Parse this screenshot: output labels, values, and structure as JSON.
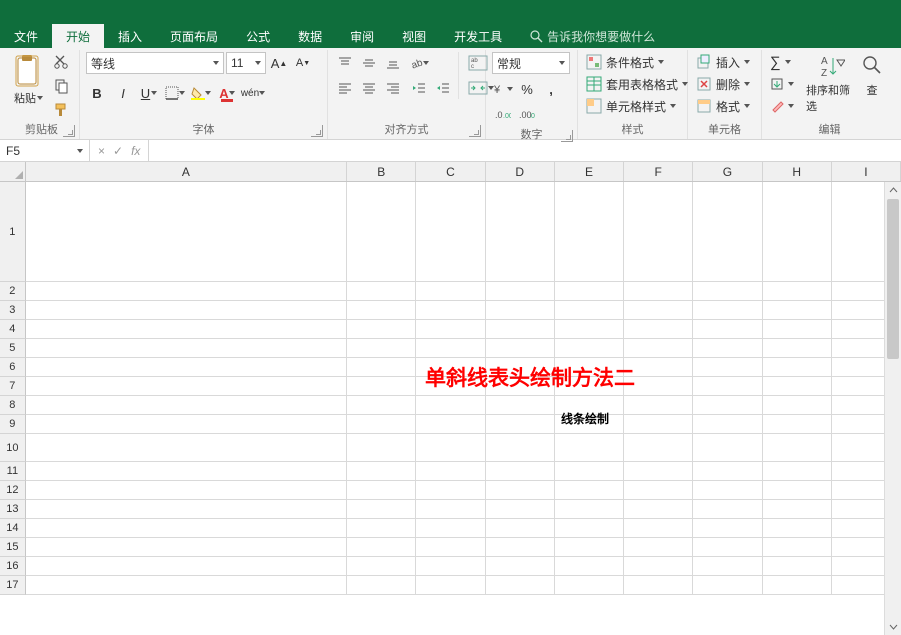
{
  "tabs": {
    "file": "文件",
    "home": "开始",
    "insert": "插入",
    "layout": "页面布局",
    "formulas": "公式",
    "data": "数据",
    "review": "审阅",
    "view": "视图",
    "developer": "开发工具",
    "tellme_placeholder": "告诉我你想要做什么"
  },
  "ribbon": {
    "clipboard": {
      "label": "剪贴板",
      "paste": "粘贴"
    },
    "font": {
      "label": "字体",
      "name": "等线",
      "size": "11",
      "bold": "B",
      "italic": "I",
      "underline": "U",
      "phonetic": "wén"
    },
    "alignment": {
      "label": "对齐方式"
    },
    "number": {
      "label": "数字",
      "format": "常规"
    },
    "styles": {
      "label": "样式",
      "conditional": "条件格式",
      "table": "套用表格格式",
      "cell": "单元格样式"
    },
    "cells": {
      "label": "单元格",
      "insert": "插入",
      "delete": "删除",
      "format": "格式"
    },
    "editing": {
      "label": "编辑",
      "sort": "排序和筛选",
      "find": "查"
    }
  },
  "namebox": "F5",
  "fx": {
    "x": "×",
    "check": "✓",
    "fx": "fx"
  },
  "columns": [
    "A",
    "B",
    "C",
    "D",
    "E",
    "F",
    "G",
    "H",
    "I"
  ],
  "rows": [
    1,
    2,
    3,
    4,
    5,
    6,
    7,
    8,
    9,
    10,
    11,
    12,
    13,
    14,
    15,
    16,
    17
  ],
  "sheet": {
    "overlay_title": "单斜线表头绘制方法二",
    "e12": "线条绘制"
  },
  "colors": {
    "green": "#0f6e3c",
    "red": "#ff0000"
  }
}
